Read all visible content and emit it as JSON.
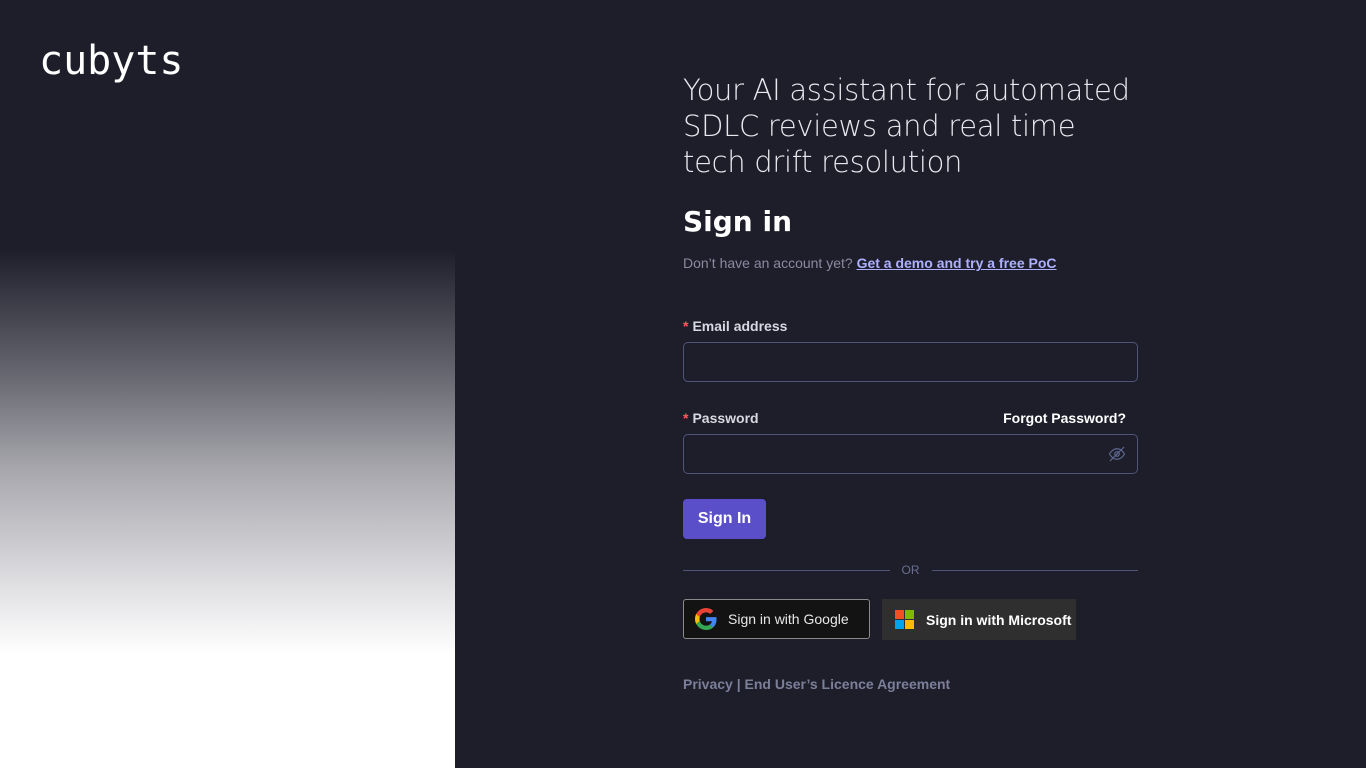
{
  "brand": {
    "logo_text": "cubyts"
  },
  "hero": {
    "tagline": "Your AI assistant for automated SDLC reviews and real time tech drift resolution"
  },
  "signin": {
    "title": "Sign in",
    "no_account_text": "Don’t have an account yet?",
    "demo_link": "Get a demo and try a free PoC",
    "required_marker": "*",
    "email_label": "Email address",
    "email_value": "",
    "password_label": "Password",
    "password_value": "",
    "forgot_password": "Forgot Password?",
    "password_toggle_icon": "eye-off-icon",
    "submit_label": "Sign In",
    "divider_text": "OR"
  },
  "social": {
    "google_label": "Sign in with Google",
    "google_icon": "google-logo-icon",
    "microsoft_label": "Sign in with Microsoft",
    "microsoft_icon": "microsoft-logo-icon"
  },
  "footer": {
    "privacy": "Privacy",
    "separator": "|",
    "eula": "End User’s Licence Agreement"
  },
  "colors": {
    "background": "#1e1e2b",
    "accent": "#5a4fc8",
    "link": "#aeb0ff",
    "required": "#ff5a5a",
    "input_border": "#4f5578"
  }
}
